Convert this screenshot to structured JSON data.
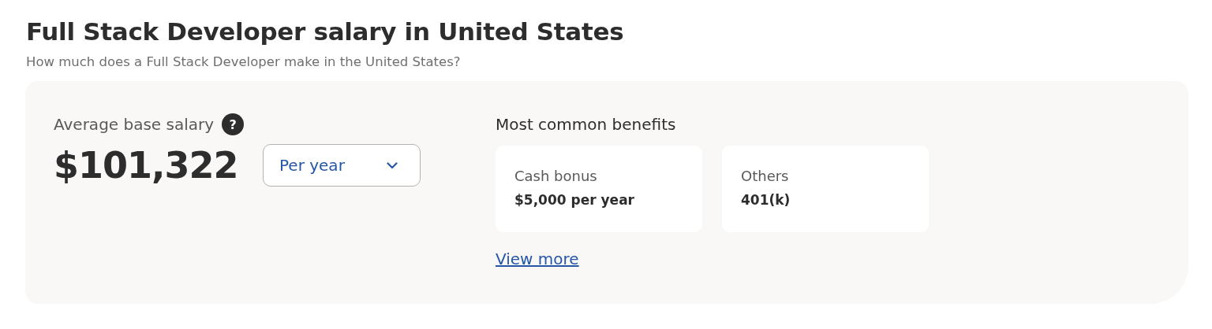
{
  "page": {
    "title": "Full Stack Developer salary in United States",
    "subtitle": "How much does a Full Stack Developer make in the United States?"
  },
  "salary": {
    "label": "Average base salary",
    "help_icon": "?",
    "amount": "$101,322",
    "period_dropdown": {
      "value": "Per year"
    }
  },
  "benefits": {
    "heading": "Most common benefits",
    "items": [
      {
        "label": "Cash bonus",
        "value": "$5,000 per year"
      },
      {
        "label": "Others",
        "value": "401(k)"
      }
    ],
    "link": "View more"
  }
}
